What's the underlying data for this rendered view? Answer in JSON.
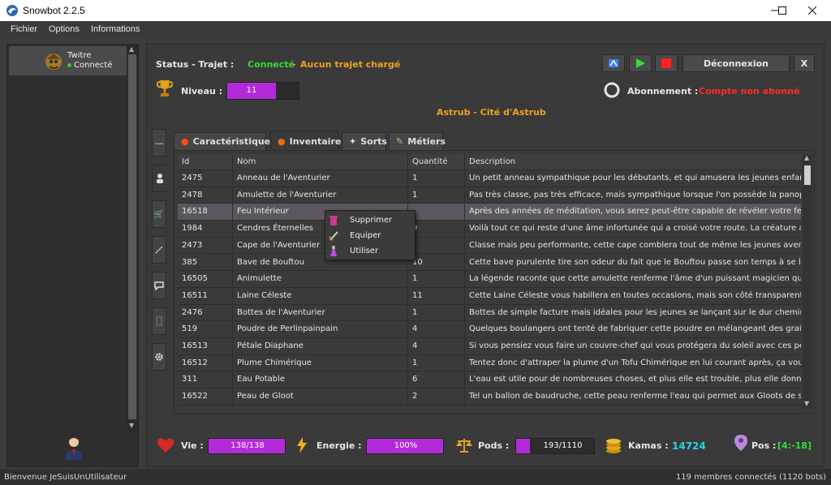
{
  "window": {
    "title": "Snowbot 2.2.5"
  },
  "menu": [
    "Fichier",
    "Options",
    "Informations"
  ],
  "account": {
    "name": "Twitre",
    "status": "Connecté"
  },
  "header": {
    "status_label": "Status - Trajet :",
    "status_value": "Connecté",
    "separator": "-",
    "trajet_value": "Aucun trajet chargé",
    "level_label": "Niveau :",
    "level_value": "11",
    "subscription_label": "Abonnement :",
    "subscription_value": "Compte non abonné",
    "location": "Astrub - Cité d'Astrub",
    "disconnect_label": "Déconnexion",
    "close_label": "X"
  },
  "tabs": [
    {
      "label": "Caractéristiques",
      "active": false
    },
    {
      "label": "Inventaire",
      "active": true
    },
    {
      "label": "Sorts",
      "active": false
    },
    {
      "label": "Métiers",
      "active": false
    }
  ],
  "table": {
    "columns": [
      "Id",
      "Nom",
      "Quantité",
      "Description"
    ],
    "rows": [
      [
        "2475",
        "Anneau de l'Aventurier",
        "1",
        "Un petit anneau sympathique pour les débutants, et qui amusera les jeunes enfants, ou le"
      ],
      [
        "2478",
        "Amulette de l'Aventurier",
        "1",
        "Pas très classe, pas très efficace, mais sympathique lorsque l'on possède la panoplie."
      ],
      [
        "16518",
        "Feu Intérieur",
        "",
        "Après des années de méditation, vous serez peut-être capable de révéler votre feu intéri"
      ],
      [
        "1984",
        "Cendres Éternelles",
        "9",
        "Voilà tout ce qui reste d'une âme infortunée qui a croisé votre route. La créature a comm"
      ],
      [
        "2473",
        "Cape de l'Aventurier",
        "",
        "Classe mais peu performante, cette cape comblera tout de même les jeunes aventuriers."
      ],
      [
        "385",
        "Bave de Bouftou",
        "10",
        "Cette bave purulente tire son odeur du fait que le Bouftou passe son temps à se lécher l"
      ],
      [
        "16505",
        "Animulette",
        "1",
        "La légende raconte que cette amulette renferme l'âme d'un puissant magicien qui avait c"
      ],
      [
        "16511",
        "Laine Céleste",
        "11",
        "Cette Laine Céleste vous habillera en toutes occasions, mais son côté transparent peut se"
      ],
      [
        "2476",
        "Bottes de l'Aventurier",
        "1",
        "Bottes de simple facture mais idéales pour les jeunes se lançant sur le dur chemin de l'av"
      ],
      [
        "519",
        "Poudre de Perlinpainpain",
        "4",
        "Quelques boulangers ont tenté de fabriquer cette poudre en mélangeant des graines de"
      ],
      [
        "16513",
        "Pétale Diaphane",
        "4",
        "Si vous pensiez vous faire un couvre-chef qui vous protégera du soleil avec ces pétales, v"
      ],
      [
        "16512",
        "Plume Chimérique",
        "1",
        "Tentez donc d'attraper la plume d'un Tofu Chimérique en lui courant après, ça vous fera"
      ],
      [
        "311",
        "Eau Potable",
        "6",
        "L'eau est utile pour de nombreuses choses, et plus elle est trouble, plus elle donnera de"
      ],
      [
        "16522",
        "Peau de Gloot",
        "2",
        "Tel un ballon de baudruche, cette peau renferme l'eau qui permet aux Gloots de survivre"
      ]
    ]
  },
  "context_menu": [
    "Supprimer",
    "Equiper",
    "Utiliser"
  ],
  "stats": {
    "vie_label": "Vie :",
    "vie_value": "138/138",
    "energie_label": "Energie :",
    "energie_value": "100%",
    "pods_label": "Pods :",
    "pods_value": "193/1110",
    "pods_fraction": 0.174,
    "kamas_label": "Kamas :",
    "kamas_value": "14724",
    "pos_label": "Pos :",
    "pos_value": "[4:-18]"
  },
  "statusbar": {
    "left": "Bienvenue JeSuisUnUtilisateur",
    "right": "119 membres connectés (1120 bots)"
  },
  "colors": {
    "accent": "#b32bd9",
    "ok": "#33dd33",
    "warn": "#f0a020",
    "error": "#ff2a2a",
    "kamas": "#29d4e0"
  }
}
